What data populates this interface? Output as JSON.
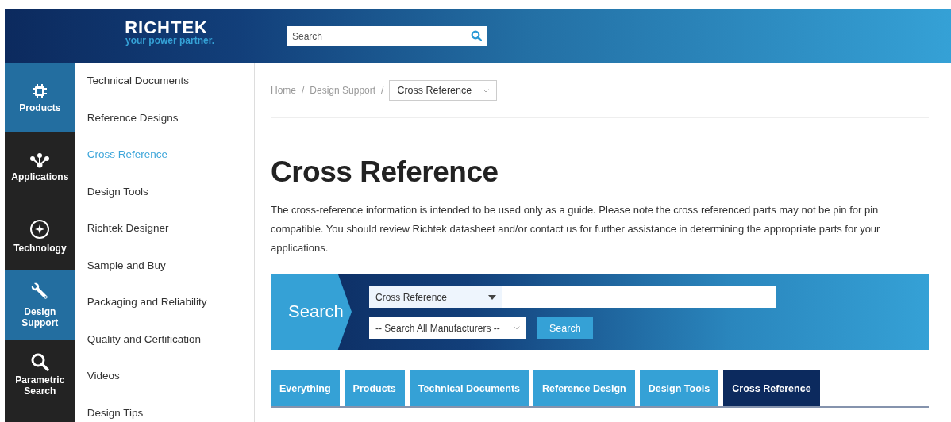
{
  "header": {
    "logo": "RICHTEK",
    "tagline": "your power partner.",
    "search": {
      "placeholder": "Search"
    }
  },
  "rail": [
    {
      "label": "Products",
      "selected": true
    },
    {
      "label": "Applications",
      "selected": false
    },
    {
      "label": "Technology",
      "selected": false
    },
    {
      "label": "Design Support",
      "selected": true
    },
    {
      "label": "Parametric Search",
      "selected": false
    }
  ],
  "submenu": [
    {
      "label": "Technical Documents",
      "selected": false
    },
    {
      "label": "Reference Designs",
      "selected": false
    },
    {
      "label": "Cross Reference",
      "selected": true
    },
    {
      "label": "Design Tools",
      "selected": false
    },
    {
      "label": "Richtek Designer",
      "selected": false
    },
    {
      "label": "Sample and Buy",
      "selected": false
    },
    {
      "label": "Packaging and Reliability",
      "selected": false
    },
    {
      "label": "Quality and Certification",
      "selected": false
    },
    {
      "label": "Videos",
      "selected": false
    },
    {
      "label": "Design Tips",
      "selected": false
    }
  ],
  "breadcrumb": {
    "items": [
      {
        "label": "Home",
        "separator": "/"
      },
      {
        "label": "Design Support",
        "separator": "/"
      }
    ],
    "current": "Cross Reference"
  },
  "title": "Cross Reference",
  "intro": "The cross-reference information is intended to be used only as a guide. Please note the cross referenced parts may not be pin for pin compatible. You should review Richtek datasheet and/or contact us for further assistance in determining the appropriate parts for your applications.",
  "search_panel": {
    "label": "Search",
    "category": "Cross Reference",
    "manufacturer": "-- Search All Manufacturers --",
    "button": "Search"
  },
  "tabs": [
    {
      "label": "Everything",
      "selected": false
    },
    {
      "label": "Products",
      "selected": false
    },
    {
      "label": "Technical Documents",
      "selected": false
    },
    {
      "label": "Reference Design",
      "selected": false
    },
    {
      "label": "Design Tools",
      "selected": false
    },
    {
      "label": "Cross Reference",
      "selected": true
    }
  ]
}
